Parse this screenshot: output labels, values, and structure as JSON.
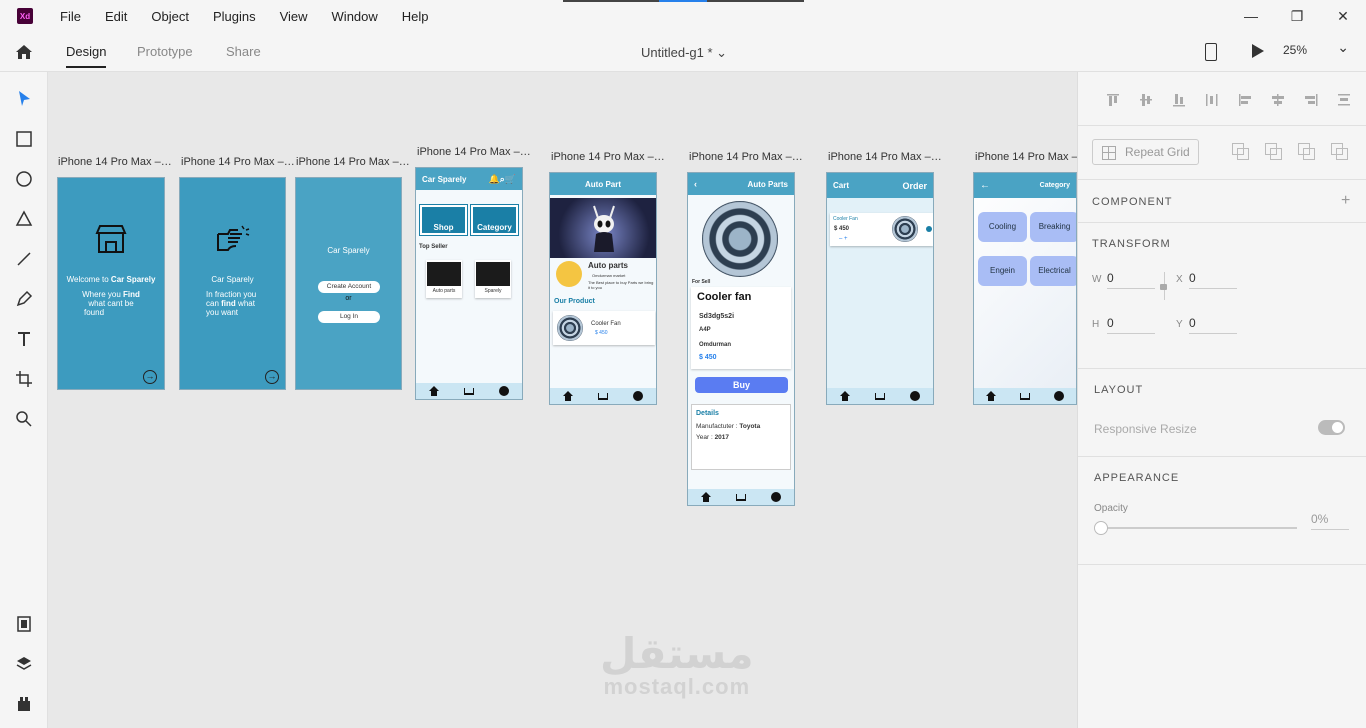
{
  "app": {
    "logo": "Xd"
  },
  "menu": [
    "File",
    "Edit",
    "Object",
    "Plugins",
    "View",
    "Window",
    "Help"
  ],
  "window_controls": {
    "minimize": "—",
    "restore": "❐",
    "close": "✕"
  },
  "modes": {
    "design": "Design",
    "prototype": "Prototype",
    "share": "Share"
  },
  "document": {
    "title": "Untitled-g1 *  ⌄"
  },
  "zoom": "25%",
  "artboards": {
    "label": "iPhone 14 Pro Max –…",
    "a1": {
      "welcome": "Welcome to",
      "brand": "Car Sparely",
      "where": "Where you",
      "find": "Find",
      "cant": "what cant be",
      "found": "found"
    },
    "a2": {
      "brand": "Car Sparely",
      "in_fraction": "In fraction you",
      "can": "can",
      "find": "find",
      "what": "what",
      "you_want": "you want"
    },
    "a3": {
      "brand": "Car Sparely",
      "create": "Create Account",
      "or": "or",
      "login": "Log In"
    },
    "a4": {
      "header": "Car Sparely",
      "shop": "Shop",
      "category": "Category",
      "top_seller": "Top Seller",
      "card1": "Auto parts",
      "card2": "Sparely"
    },
    "a5": {
      "header": "Auto Part",
      "store": "Auto parts",
      "store_sub": "Omdurman market",
      "tagline": "The Best place to buy Parts we bring it to you",
      "our_product": "Our Product",
      "product": "Cooler Fan",
      "price": "$ 450"
    },
    "a6": {
      "header": "Auto Parts",
      "for_sell": "For Sell",
      "name": "Cooler fan",
      "code": "Sd3dg5s2i",
      "brand": "A4P",
      "location": "Omdurman",
      "price": "$  450",
      "buy": "Buy",
      "details": "Details",
      "manufacturer_label": "Manufactuter :",
      "manufacturer": "Toyota",
      "year_label": "Year :",
      "year": "2017"
    },
    "a7": {
      "cart": "Cart",
      "order": "Order",
      "item": "Cooler Fan",
      "price": "$ 450",
      "qty": "–   +"
    },
    "a8": {
      "header": "Category",
      "c1": "Cooling",
      "c2": "Breaking",
      "c3": "Engein",
      "c4": "Electrical"
    }
  },
  "panel": {
    "repeat_grid": "Repeat Grid",
    "component": "COMPONENT",
    "transform": "TRANSFORM",
    "w_label": "W",
    "w": "0",
    "x_label": "X",
    "x": "0",
    "h_label": "H",
    "h": "0",
    "y_label": "Y",
    "y": "0",
    "layout": "LAYOUT",
    "responsive_resize": "Responsive Resize",
    "appearance": "APPEARANCE",
    "opacity_label": "Opacity",
    "opacity": "0%"
  },
  "watermark": {
    "arabic": "مستقل",
    "latin": "mostaql.com"
  }
}
